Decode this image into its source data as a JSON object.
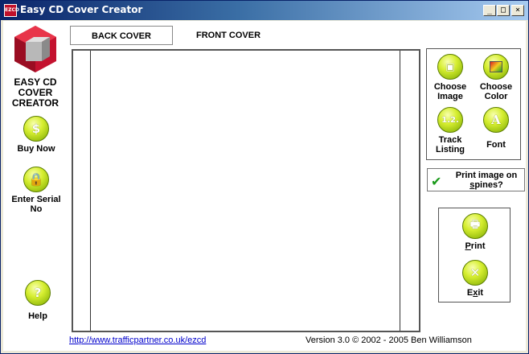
{
  "window": {
    "title": "Easy CD Cover Creator",
    "icon_text": "EZCD",
    "controls": {
      "minimize": "_",
      "maximize": "□",
      "close": "×"
    }
  },
  "sidebar": {
    "logo_text": [
      "EASY CD",
      "COVER",
      "CREATOR"
    ],
    "buy_now": "Buy Now",
    "enter_serial": [
      "Enter Serial",
      "No"
    ],
    "help": "Help"
  },
  "tabs": [
    {
      "label": "BACK COVER",
      "active": true
    },
    {
      "label": "FRONT COVER",
      "active": false
    }
  ],
  "tools": {
    "choose_image": [
      "Choose",
      "Image"
    ],
    "choose_color": [
      "Choose",
      "Color"
    ],
    "track_listing": [
      "Track",
      "Listing"
    ],
    "font": "Font"
  },
  "spines_option": {
    "label_line1": "Print image on",
    "label_line2_pre": "",
    "label_line2_u": "s",
    "label_line2_post": "pines?",
    "checked": true
  },
  "actions": {
    "print_u": "P",
    "print_rest": "rint",
    "exit_pre": "E",
    "exit_u": "x",
    "exit_post": "it"
  },
  "footer": {
    "link": "http://www.trafficpartner.co.uk/ezcd",
    "version": "Version 3.0 © 2002 - 2005 Ben Williamson"
  },
  "colors": {
    "title_gradient_start": "#0a246a",
    "orb_green": "#d6ee30",
    "check_green": "#1a9a1a",
    "link_blue": "#0000cc"
  }
}
